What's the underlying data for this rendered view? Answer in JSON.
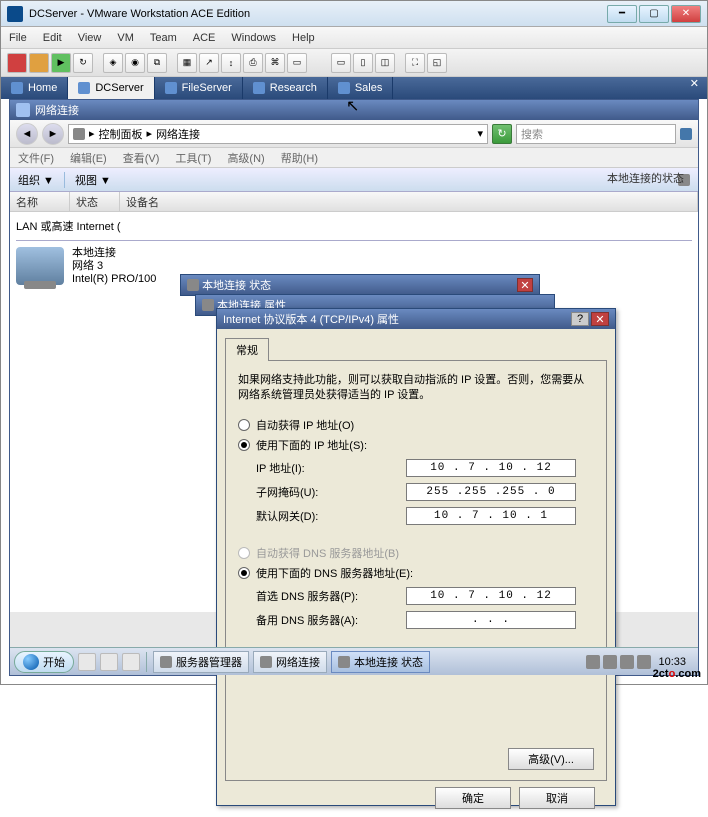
{
  "vmware": {
    "title": "DCServer - VMware Workstation ACE Edition",
    "menu": [
      "File",
      "Edit",
      "View",
      "VM",
      "Team",
      "ACE",
      "Windows",
      "Help"
    ],
    "tabs": [
      {
        "label": "Home",
        "icon": "home"
      },
      {
        "label": "DCServer",
        "icon": "vm",
        "active": true
      },
      {
        "label": "FileServer",
        "icon": "vm"
      },
      {
        "label": "Research",
        "icon": "vm"
      },
      {
        "label": "Sales",
        "icon": "vm"
      }
    ]
  },
  "guest": {
    "window_title": "网络连接",
    "breadcrumb_prefix": "控制面板",
    "breadcrumb_current": "网络连接",
    "search_placeholder": "搜索",
    "menubar": [
      "文件(F)",
      "编辑(E)",
      "查看(V)",
      "工具(T)",
      "高级(N)",
      "帮助(H)"
    ],
    "cmdbar": {
      "org": "组织 ▼",
      "view": "视图 ▼"
    },
    "columns": [
      "名称",
      "状态",
      "设备名"
    ],
    "group": "LAN 或高速 Internet (",
    "connection": {
      "name": "本地连接",
      "net": "网络 3",
      "device": "Intel(R) PRO/100"
    },
    "side_hint": "本地连接的状态"
  },
  "status_window": {
    "title": "本地连接 状态"
  },
  "prop_window_back": {
    "title": "本地连接 属性"
  },
  "tcpip": {
    "title": "Internet 协议版本 4 (TCP/IPv4) 属性",
    "tab": "常规",
    "desc": "如果网络支持此功能，则可以获取自动指派的 IP 设置。否则，您需要从网络系统管理员处获得适当的 IP 设置。",
    "radio_auto_ip": "自动获得 IP 地址(O)",
    "radio_manual_ip": "使用下面的 IP 地址(S):",
    "ip_label": "IP 地址(I):",
    "ip_value": "10 . 7 . 10 . 12",
    "mask_label": "子网掩码(U):",
    "mask_value": "255 .255 .255 . 0",
    "gw_label": "默认网关(D):",
    "gw_value": "10 . 7 . 10 . 1",
    "radio_auto_dns": "自动获得 DNS 服务器地址(B)",
    "radio_manual_dns": "使用下面的 DNS 服务器地址(E):",
    "dns1_label": "首选 DNS 服务器(P):",
    "dns1_value": "10 . 7 . 10 . 12",
    "dns2_label": "备用 DNS 服务器(A):",
    "dns2_value": " .   .   . ",
    "advanced": "高级(V)...",
    "ok": "确定",
    "cancel": "取消"
  },
  "taskbar": {
    "start": "开始",
    "items": [
      {
        "label": "服务器管理器"
      },
      {
        "label": "网络连接"
      },
      {
        "label": "本地连接 状态",
        "active": true
      }
    ],
    "clock": "10:33"
  },
  "watermark": {
    "a": "2ct",
    "b": "o",
    "c": ".com"
  }
}
